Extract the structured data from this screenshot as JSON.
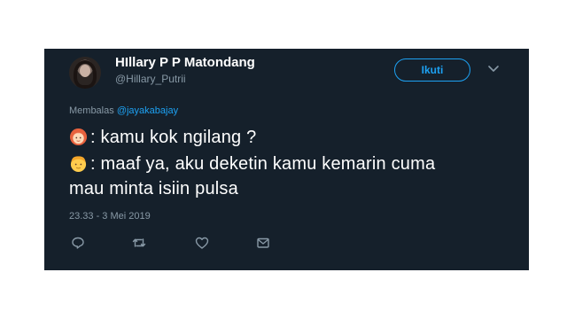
{
  "tweet": {
    "display_name": "HIllary P P Matondang",
    "handle": "@Hillary_Putrii",
    "follow_label": "Ikuti",
    "replying_prefix": "Membalas",
    "replying_to": "@jayakabajay",
    "line1_text": ": kamu kok ngilang ?",
    "line2_text": ": maaf ya, aku deketin kamu kemarin cuma",
    "line3_text": "mau minta isiin pulsa",
    "emoji1": "woman-face-icon",
    "emoji2": "man-face-icon",
    "timestamp": "23.33 - 3 Mei 2019"
  },
  "actions": [
    "reply-icon",
    "retweet-icon",
    "like-icon",
    "direct-message-icon"
  ],
  "colors": {
    "card_background": "#15202b",
    "accent": "#1da1f2",
    "secondary_text": "#8899a6",
    "primary_text": "#ffffff"
  }
}
